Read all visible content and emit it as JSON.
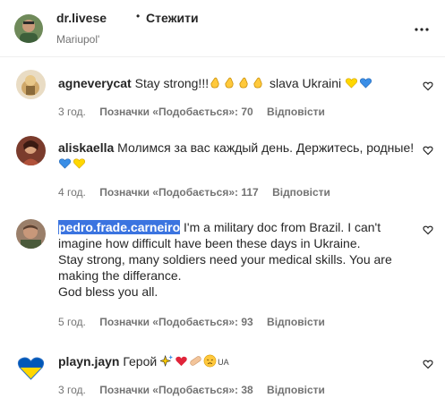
{
  "header": {
    "username": "dr.livese",
    "separator": "•",
    "follow_label": "Стежити",
    "location": "Mariupol'",
    "more_icon": "more-horizontal-icon"
  },
  "comments": [
    {
      "username": "agneverycat",
      "text_before": "Stay strong!!!",
      "text_after": " slava Ukraini ",
      "emojis_before": [
        "clapping-hands-icon",
        "clapping-hands-icon",
        "clapping-hands-icon",
        "clapping-hands-icon"
      ],
      "emojis_after": [
        "yellow-heart-icon",
        "blue-heart-icon"
      ],
      "time": "3 год.",
      "likes": "Позначки «Подобається»: 70",
      "reply": "Відповісти"
    },
    {
      "username": "aliskaella",
      "text_before": "Молимся за вас каждый день. Держитесь, родные!",
      "emojis_after": [
        "blue-heart-icon",
        "yellow-heart-icon"
      ],
      "time": "4 год.",
      "likes": "Позначки «Подобається»: 117",
      "reply": "Відповісти"
    },
    {
      "username": "pedro.frade.carneiro",
      "text_lines": [
        "I'm a military doc from Brazil. I can't",
        "imagine how difficult have been these days in Ukraine.",
        "Stay strong, many soldiers need your medical skills. You are",
        "making the differance.",
        "God bless you all."
      ],
      "time": "5 год.",
      "likes": "Позначки «Подобається»: 93",
      "reply": "Відповісти"
    },
    {
      "username": "playn.jayn",
      "text_before": "Герой ",
      "emojis_after": [
        "sparkles-icon",
        "red-heart-icon",
        "bandage-icon",
        "weary-face-icon",
        "ukraine-flag-icon"
      ],
      "flag_text": "UA",
      "time": "3 год.",
      "likes": "Позначки «Подобається»: 38",
      "reply": "Відповісти"
    }
  ],
  "colors": {
    "text": "#262626",
    "secondary": "#737373",
    "selection": "#3b74e0",
    "ukraine_blue": "#0057b7",
    "ukraine_yellow": "#ffd700"
  }
}
